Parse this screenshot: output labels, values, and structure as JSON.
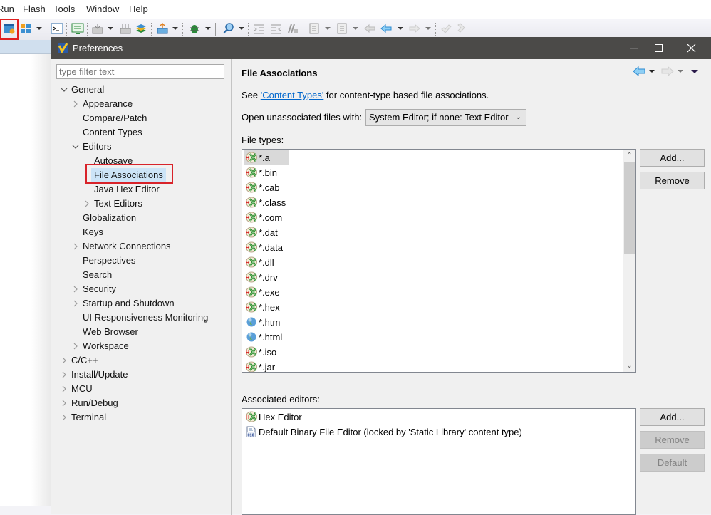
{
  "menubar": {
    "items": [
      "Run",
      "Flash",
      "Tools",
      "Window",
      "Help"
    ]
  },
  "toolbar": {
    "icons": [
      "preferences-icon",
      "perspective-icon",
      "terminal-icon",
      "console-icon",
      "download-icon",
      "flash-download-icon",
      "layers-icon",
      "export-icon",
      "debug-bug-icon",
      "search-icon",
      "indent-icon",
      "outdent-icon",
      "comment-icon",
      "annotation-icon",
      "outline-icon",
      "back-history-icon",
      "back-icon",
      "forward-icon",
      "undo-icon",
      "redo-icon"
    ]
  },
  "dialog": {
    "title": "Preferences",
    "filter_placeholder": "type filter text",
    "tree": [
      {
        "label": "General",
        "level": 0,
        "state": "expanded"
      },
      {
        "label": "Appearance",
        "level": 1,
        "state": "collapsed"
      },
      {
        "label": "Compare/Patch",
        "level": 1,
        "state": "leaf"
      },
      {
        "label": "Content Types",
        "level": 1,
        "state": "leaf"
      },
      {
        "label": "Editors",
        "level": 1,
        "state": "expanded"
      },
      {
        "label": "Autosave",
        "level": 2,
        "state": "leaf"
      },
      {
        "label": "File Associations",
        "level": 2,
        "state": "leaf",
        "selected": true
      },
      {
        "label": "Java Hex Editor",
        "level": 2,
        "state": "leaf"
      },
      {
        "label": "Text Editors",
        "level": 2,
        "state": "collapsed"
      },
      {
        "label": "Globalization",
        "level": 1,
        "state": "leaf"
      },
      {
        "label": "Keys",
        "level": 1,
        "state": "leaf"
      },
      {
        "label": "Network Connections",
        "level": 1,
        "state": "collapsed"
      },
      {
        "label": "Perspectives",
        "level": 1,
        "state": "leaf"
      },
      {
        "label": "Search",
        "level": 1,
        "state": "leaf"
      },
      {
        "label": "Security",
        "level": 1,
        "state": "collapsed"
      },
      {
        "label": "Startup and Shutdown",
        "level": 1,
        "state": "collapsed"
      },
      {
        "label": "UI Responsiveness Monitoring",
        "level": 1,
        "state": "leaf"
      },
      {
        "label": "Web Browser",
        "level": 1,
        "state": "leaf"
      },
      {
        "label": "Workspace",
        "level": 1,
        "state": "collapsed"
      },
      {
        "label": "C/C++",
        "level": 0,
        "state": "collapsed"
      },
      {
        "label": "Install/Update",
        "level": 0,
        "state": "collapsed"
      },
      {
        "label": "MCU",
        "level": 0,
        "state": "collapsed"
      },
      {
        "label": "Run/Debug",
        "level": 0,
        "state": "collapsed"
      },
      {
        "label": "Terminal",
        "level": 0,
        "state": "collapsed"
      }
    ],
    "page": {
      "title": "File Associations",
      "see_prefix": "See ",
      "see_link": "'Content Types'",
      "see_suffix": " for content-type based file associations.",
      "open_label": "Open unassociated files with:",
      "open_value": "System Editor; if none: Text Editor",
      "file_types_label": "File types:",
      "file_types": [
        {
          "name": "*.a",
          "icon": "hex-editor-icon",
          "selected": true
        },
        {
          "name": "*.bin",
          "icon": "hex-editor-icon"
        },
        {
          "name": "*.cab",
          "icon": "hex-editor-icon"
        },
        {
          "name": "*.class",
          "icon": "hex-editor-icon"
        },
        {
          "name": "*.com",
          "icon": "hex-editor-icon"
        },
        {
          "name": "*.dat",
          "icon": "hex-editor-icon"
        },
        {
          "name": "*.data",
          "icon": "hex-editor-icon"
        },
        {
          "name": "*.dll",
          "icon": "hex-editor-icon"
        },
        {
          "name": "*.drv",
          "icon": "hex-editor-icon"
        },
        {
          "name": "*.exe",
          "icon": "hex-editor-icon"
        },
        {
          "name": "*.hex",
          "icon": "hex-editor-icon"
        },
        {
          "name": "*.htm",
          "icon": "globe-icon"
        },
        {
          "name": "*.html",
          "icon": "globe-icon"
        },
        {
          "name": "*.iso",
          "icon": "hex-editor-icon"
        },
        {
          "name": "*.jar",
          "icon": "hex-editor-icon"
        }
      ],
      "file_types_buttons": {
        "add": "Add...",
        "remove": "Remove"
      },
      "associated_label": "Associated editors:",
      "associated_editors": [
        {
          "name": "Hex Editor",
          "icon": "hex-editor-icon"
        },
        {
          "name": "Default Binary File Editor (locked by 'Static Library' content type)",
          "icon": "binary-file-icon"
        }
      ],
      "associated_buttons": {
        "add": "Add...",
        "remove": "Remove",
        "default": "Default"
      }
    }
  }
}
